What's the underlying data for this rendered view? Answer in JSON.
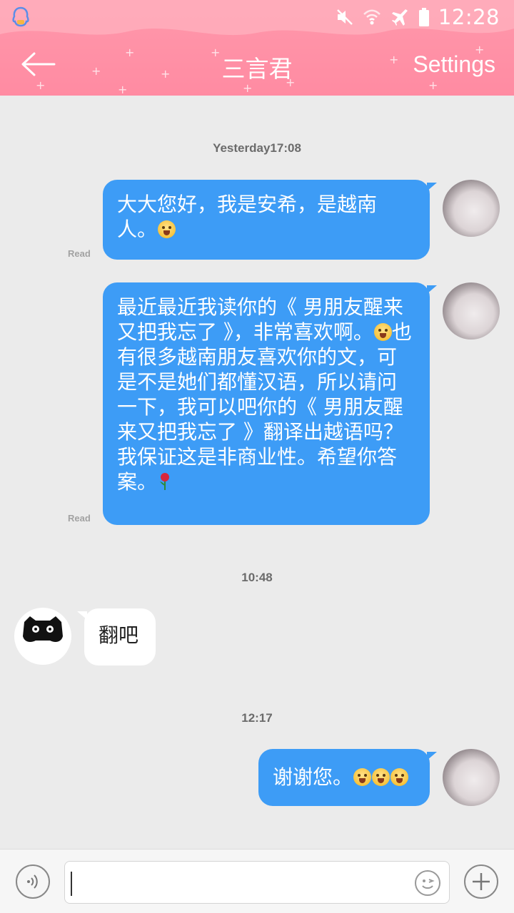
{
  "status_bar": {
    "time": "12:28",
    "icons": [
      "qq-icon",
      "mute-icon",
      "wifi-icon",
      "airplane-icon",
      "battery-icon"
    ]
  },
  "header": {
    "title": "三言君",
    "settings_label": "Settings",
    "back_icon": "arrow-left-icon",
    "color": "#ff8ba2"
  },
  "messages": {
    "ts1": "Yesterday17:08",
    "m1_read": "Read",
    "m1_text": "大大您好，我是安希，是越南人。",
    "m2_read": "Read",
    "m2_text_a": "最近最近我读你的《 男朋友醒来又把我忘了 》，非常喜欢啊。",
    "m2_text_b": "也有很多越南朋友喜欢你的文，可是不是她们都懂汉语，所以请问一下，我可以吧你的《 男朋友醒来又把我忘了 》翻译出越语吗？我保证这是非商业性。希望你答案。",
    "ts2": "10:48",
    "m3_text": "翻吧",
    "ts3": "12:17",
    "m4_text": "谢谢您。"
  },
  "input": {
    "voice_icon": "voice-icon",
    "emoji_icon": "smiley-icon",
    "plus_icon": "plus-icon"
  },
  "colors": {
    "bubble_me": "#3d9cf6",
    "bubble_other": "#ffffff",
    "background": "#ebebeb"
  }
}
